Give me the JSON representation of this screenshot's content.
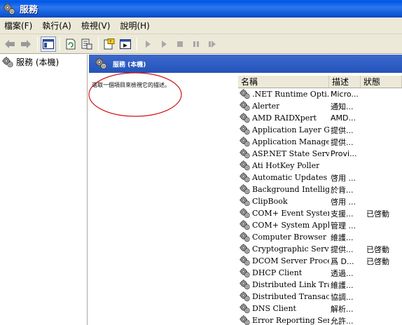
{
  "window": {
    "title": "服務"
  },
  "menu": {
    "items": [
      "檔案(F)",
      "執行(A)",
      "檢視(V)",
      "說明(H)"
    ]
  },
  "tree": {
    "root_label": "服務 (本機)"
  },
  "right_header": {
    "label": "服務 (本機)"
  },
  "description": {
    "text": "選取一個項目來檢視它的描述。"
  },
  "annotation_color": "#d01010",
  "columns": {
    "name": "名稱",
    "desc": "描述",
    "status": "狀態"
  },
  "services": [
    {
      "name": ".NET Runtime Opti...",
      "desc": "Micro...",
      "status": ""
    },
    {
      "name": "Alerter",
      "desc": "通知...",
      "status": ""
    },
    {
      "name": "AMD RAIDXpert",
      "desc": "AMD...",
      "status": ""
    },
    {
      "name": "Application Layer G...",
      "desc": "提供...",
      "status": ""
    },
    {
      "name": "Application Manage...",
      "desc": "提供...",
      "status": ""
    },
    {
      "name": "ASP.NET State Servi...",
      "desc": "Provi...",
      "status": ""
    },
    {
      "name": "Ati HotKey Poller",
      "desc": "",
      "status": ""
    },
    {
      "name": "Automatic Updates",
      "desc": "啓用 ...",
      "status": ""
    },
    {
      "name": "Background Intellig...",
      "desc": "於背...",
      "status": ""
    },
    {
      "name": "ClipBook",
      "desc": "啓用 ...",
      "status": ""
    },
    {
      "name": "COM+ Event System",
      "desc": "支援...",
      "status": "已啓動"
    },
    {
      "name": "COM+ System Appli...",
      "desc": "管理 ...",
      "status": ""
    },
    {
      "name": "Computer Browser",
      "desc": "維護...",
      "status": ""
    },
    {
      "name": "Cryptographic Servi...",
      "desc": "提供...",
      "status": "已啓動"
    },
    {
      "name": "DCOM Server Proce...",
      "desc": "爲 D...",
      "status": "已啓動"
    },
    {
      "name": "DHCP Client",
      "desc": "透過...",
      "status": ""
    },
    {
      "name": "Distributed Link Tra...",
      "desc": "維護...",
      "status": ""
    },
    {
      "name": "Distributed Transacti...",
      "desc": "協調...",
      "status": ""
    },
    {
      "name": "DNS Client",
      "desc": "解析...",
      "status": ""
    },
    {
      "name": "Error Reporting Ser...",
      "desc": "允許...",
      "status": ""
    }
  ]
}
